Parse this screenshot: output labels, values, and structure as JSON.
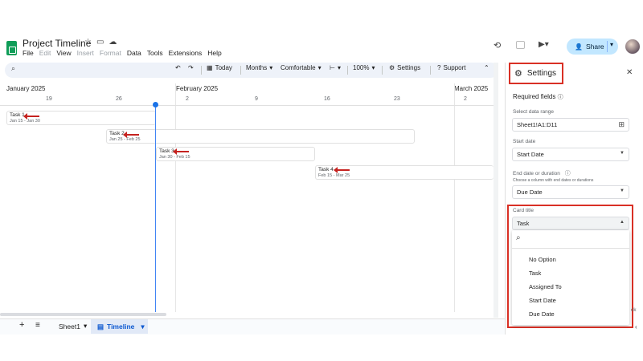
{
  "app": {
    "doc_title": "Project Timeline",
    "menu": [
      "File",
      "Edit",
      "View",
      "Insert",
      "Format",
      "Data",
      "Tools",
      "Extensions",
      "Help"
    ],
    "share_label": "Share",
    "brand_color": "#0f9d58"
  },
  "toolbar": {
    "today": "Today",
    "scale": "Months",
    "density": "Comfortable",
    "zoom": "100%",
    "settings": "Settings",
    "support": "Support"
  },
  "timeline": {
    "months": [
      "January 2025",
      "February 2025",
      "March 2025"
    ],
    "days": [
      "19",
      "26",
      "2",
      "9",
      "16",
      "23",
      "2"
    ],
    "tasks": [
      {
        "title": "Task 1",
        "dates": "Jan 15 - Jan 30"
      },
      {
        "title": "Task 2",
        "dates": "Jan 25 - Feb 25"
      },
      {
        "title": "Task 3",
        "dates": "Jan 30 - Feb 15"
      },
      {
        "title": "Task 4",
        "dates": "Feb 15 - Mar 25"
      }
    ]
  },
  "bottom": {
    "sheet1": "Sheet1",
    "timeline": "Timeline"
  },
  "settings": {
    "title": "Settings",
    "required_fields": "Required fields",
    "data_range_label": "Select data range",
    "data_range_value": "Sheet1!A1:D11",
    "start_date_label": "Start date",
    "start_date_value": "Start Date",
    "end_date_label": "End date or duration",
    "end_date_hint": "Choose a column with end dates or durations",
    "end_date_value": "Due Date",
    "card_title_label": "Card title",
    "card_title_value": "Task",
    "options": [
      "No Option",
      "Task",
      "Assigned To",
      "Start Date",
      "Due Date"
    ],
    "peek_text": "ck"
  }
}
